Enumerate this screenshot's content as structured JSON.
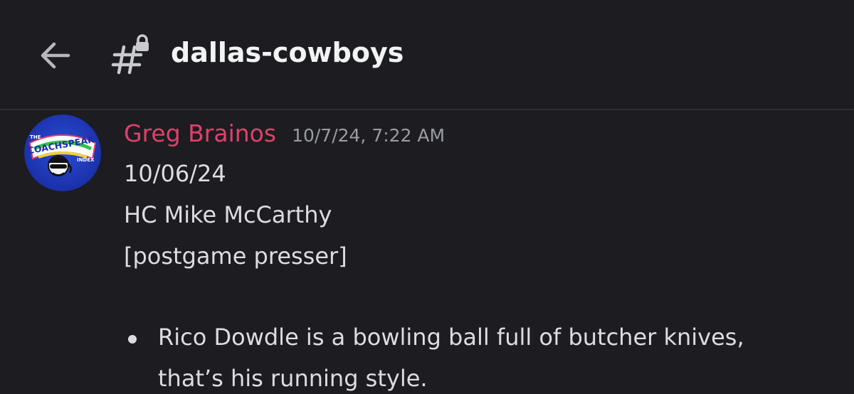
{
  "header": {
    "channel_name": "dallas-cowboys",
    "back_icon": "arrow-left-icon",
    "channel_icon": "locked-hashtag-icon"
  },
  "message": {
    "author": "Greg Brainos",
    "timestamp": "10/7/24, 7:22 AM",
    "avatar": {
      "top_text": "THE",
      "title": "COACHSPEAK",
      "sub_text": "INDEX"
    },
    "lines": [
      "10/06/24",
      "HC Mike McCarthy",
      "[postgame presser]"
    ],
    "bullets": [
      {
        "lines": [
          "Rico Dowdle is a bowling ball full of butcher knives,",
          "that’s his running style."
        ]
      }
    ]
  },
  "colors": {
    "background": "#1c1c21",
    "author": "#e0416a",
    "text": "#dcdde1",
    "muted": "#9a9ca4",
    "divider": "#2e2f35"
  }
}
